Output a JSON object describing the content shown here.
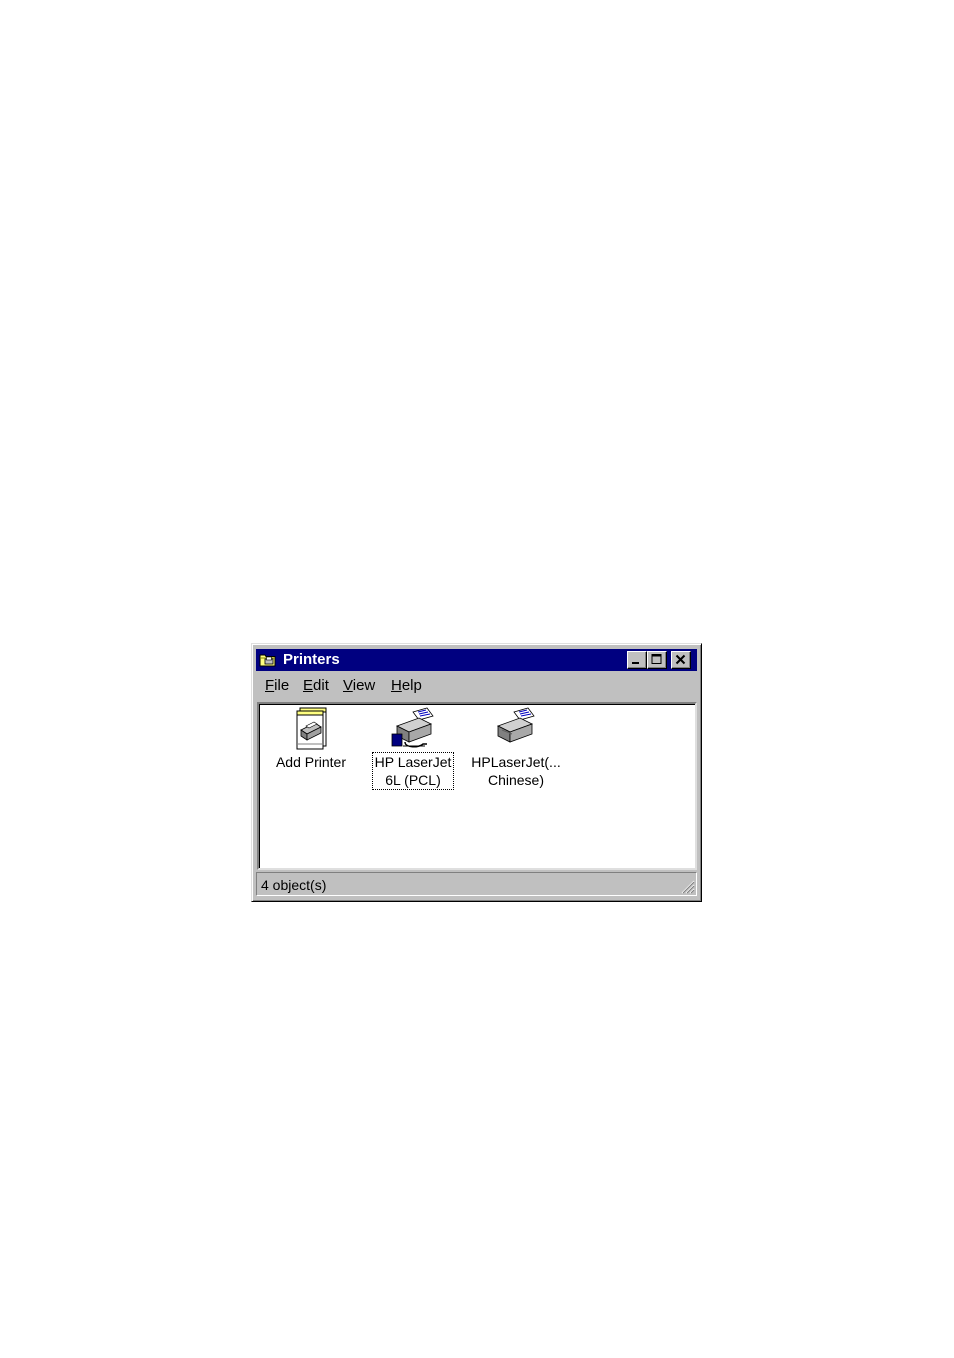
{
  "window": {
    "title": "Printers",
    "title_icon": "printers-folder-icon",
    "controls": [
      "minimize",
      "maximize",
      "close"
    ]
  },
  "menubar": {
    "items": [
      {
        "first": "F",
        "rest": "ile"
      },
      {
        "first": "E",
        "rest": "dit"
      },
      {
        "first": "V",
        "rest": "iew"
      },
      {
        "first": "H",
        "rest": "elp"
      }
    ]
  },
  "icons": [
    {
      "label": "Add Printer",
      "icon": "add-printer-icon",
      "focused": false
    },
    {
      "label": "HP LaserJet\n6L (PCL)",
      "icon": "network-printer-icon",
      "focused": true
    },
    {
      "label": "HPLaserJet(...\nChinese)",
      "icon": "printer-icon",
      "focused": false
    }
  ],
  "statusbar": {
    "text": "4 object(s)"
  },
  "colors": {
    "titlebar": "#000080",
    "face": "#c0c0c0",
    "content_bg": "#ffffff"
  }
}
